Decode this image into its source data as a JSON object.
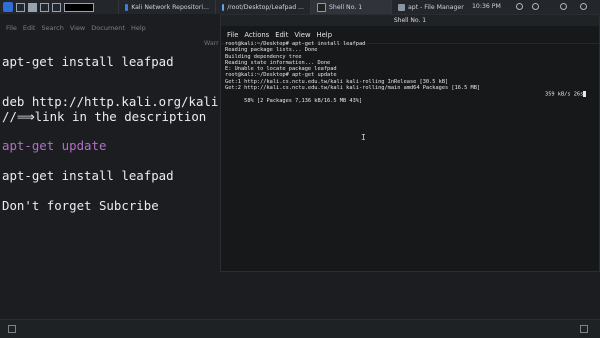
{
  "taskbar": {
    "tasks": [
      {
        "label": "Kali Network Repositori..."
      },
      {
        "label": "/root/Desktop/Leafpad ..."
      },
      {
        "label": "Shell No. 1"
      },
      {
        "label": "apt - File Manager"
      }
    ],
    "clock": "10:36 PM"
  },
  "leafpad": {
    "menu": [
      "File",
      "Edit",
      "Search",
      "View",
      "Document",
      "Help"
    ],
    "warning": "Warr",
    "lines": [
      "apt-get install leafpad",
      "deb http://http.kali.org/kali k",
      "//⟹link in the description",
      "apt-get update",
      "apt-get install leafpad",
      "Don't forget Subcribe"
    ]
  },
  "terminal": {
    "title": "Shell No. 1",
    "menu": [
      "File",
      "Actions",
      "Edit",
      "View",
      "Help"
    ],
    "lines": [
      "root@kali:~/Desktop# apt-get install leafpad",
      "Reading package lists... Done",
      "Building dependency tree",
      "Reading state information... Done",
      "E: Unable to locate package leafpad",
      "root@kali:~/Desktop# apt-get update",
      "Get:1 http://kali.cs.nctu.edu.tw/kali kali-rolling InRelease [30.5 kB]",
      "Get:2 http://kali.cs.nctu.edu.tw/kali kali-rolling/main amd64 Packages [16.5 MB]"
    ],
    "progress_line": "58% [2 Packages 7,136 kB/16.5 MB 43%]",
    "progress_speed": "359 kB/s 26s"
  },
  "colors": {
    "accent": "#2f6fd3",
    "editor_text": "#ececec",
    "editor_purple": "#b06fc6",
    "terminal_bg": "#16181a"
  }
}
